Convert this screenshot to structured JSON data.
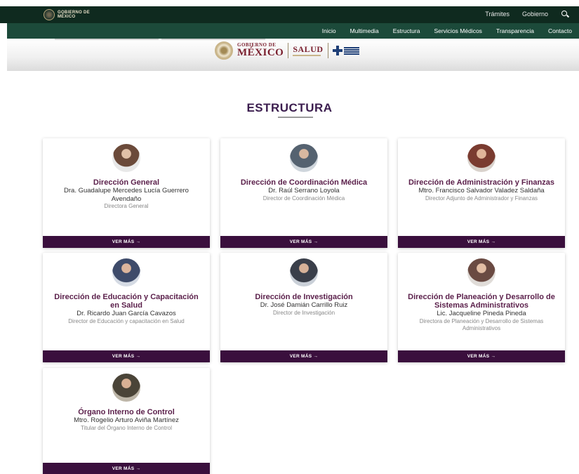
{
  "header": {
    "logo_text_1": "GOBIERNO DE",
    "logo_text_2": "MÉXICO",
    "top_links": [
      "Trámites",
      "Gobierno"
    ],
    "nav": [
      "Inicio",
      "Multimedia",
      "Estructura",
      "Servicios Médicos",
      "Transparencia",
      "Contacto"
    ]
  },
  "brand": {
    "gob_small": "GOBIERNO DE",
    "gob_big": "MÉXICO",
    "salud": "SALUD"
  },
  "section": {
    "title": "ESTRUCTURA"
  },
  "cards": [
    {
      "title": "Dirección General",
      "name": "Dra. Guadalupe Mercedes Lucía Guerrero Avendaño",
      "role": "Directora General",
      "button": "VER MÁS →",
      "avatar_color": "#6b4a3a"
    },
    {
      "title": "Dirección de Coordinación Médica",
      "name": "Dr. Raúl Serrano Loyola",
      "role": "Director de Coordinación Médica",
      "button": "VER MÁS →",
      "avatar_color": "#556270"
    },
    {
      "title": "Dirección de Administración y Finanzas",
      "name": "Mtro. Francisco Salvador Valadez Saldaña",
      "role": "Director Adjunto de Administrador y Finanzas",
      "button": "VER MÁS →",
      "avatar_color": "#7a3b30"
    },
    {
      "title": "Dirección de Educación y Capacitación en Salud",
      "name": "Dr. Ricardo Juan García Cavazos",
      "role": "Director de Educación y capacitación en Salud",
      "button": "VER MÁS →",
      "avatar_color": "#3e4b6a"
    },
    {
      "title": "Dirección de Investigación",
      "name": "Dr. José Damián Carrillo Ruiz",
      "role": "Director de Investigación",
      "button": "VER MÁS →",
      "avatar_color": "#3a3f4a"
    },
    {
      "title": "Dirección de Planeación y Desarrollo de Sistemas Administrativos",
      "name": "Lic. Jacqueline Pineda Pineda",
      "role": "Directora de Planeación y Desarrollo de Sistemas Administrativos",
      "button": "VER MÁS →",
      "avatar_color": "#6a4a42"
    },
    {
      "title": "Órgano Interno de Control",
      "name": "Mtro. Rogelio Arturo Aviña Martínez",
      "role": "Titular del Órgano Interno de Control",
      "button": "VER MÁS →",
      "avatar_color": "#4a4438"
    }
  ]
}
